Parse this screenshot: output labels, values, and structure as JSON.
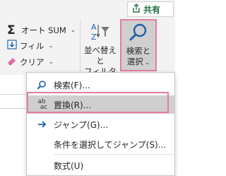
{
  "share": {
    "label": "共有",
    "icon": "share-icon"
  },
  "editing": {
    "autosum": {
      "label": "オート SUM",
      "icon": "sigma-icon"
    },
    "fill": {
      "label": "フィル",
      "icon": "fill-down-icon"
    },
    "clear": {
      "label": "クリア",
      "icon": "eraser-icon"
    },
    "sort_filter": {
      "line1": "並べ替えと",
      "line2": "フィルター",
      "icon": "sort-filter-icon"
    },
    "find_select": {
      "line1": "検索と",
      "line2": "選択",
      "icon": "magnifier-icon"
    }
  },
  "menu": {
    "items": [
      {
        "label": "検索(F)...",
        "icon": "search-icon"
      },
      {
        "label": "置換(R)...",
        "icon": "replace-icon",
        "ab": "ab",
        "ac": "ac"
      },
      {
        "label": "ジャンプ(G)...",
        "icon": "arrow-right-icon"
      },
      {
        "label": "条件を選択してジャンプ(S)..."
      },
      {
        "label": "数式(U)"
      }
    ]
  },
  "colors": {
    "accent_blue": "#1f5fa8",
    "highlight_pink": "#e57aa0",
    "share_green": "#217346"
  }
}
